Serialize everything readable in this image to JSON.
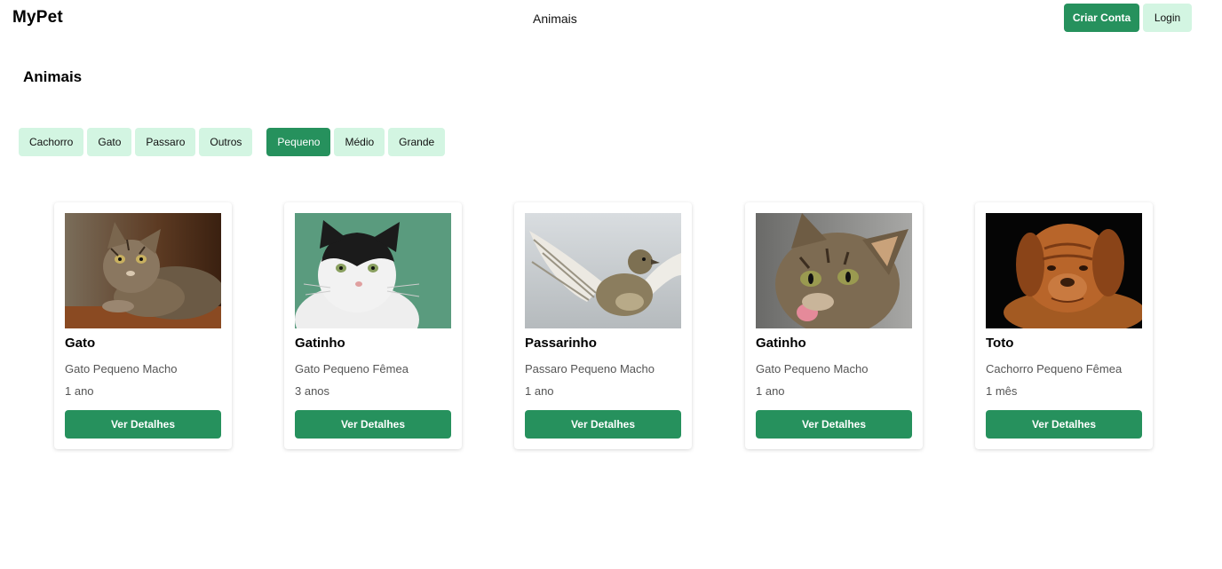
{
  "header": {
    "brand": "MyPet",
    "nav_link": "Animais",
    "signup_label": "Criar Conta",
    "login_label": "Login"
  },
  "main": {
    "title": "Animais",
    "species_filters": [
      "Cachorro",
      "Gato",
      "Passaro",
      "Outros"
    ],
    "size_filters": [
      "Pequeno",
      "Médio",
      "Grande"
    ],
    "active_size_filter": "Pequeno",
    "cards": [
      {
        "name": "Gato",
        "description": "Gato Pequeno Macho",
        "age": "1 ano",
        "button": "Ver Detalhes",
        "photo": "tabby-cat-lying-photo"
      },
      {
        "name": "Gatinho",
        "description": "Gato Pequeno Fêmea",
        "age": "3 anos",
        "button": "Ver Detalhes",
        "photo": "black-white-cat-photo"
      },
      {
        "name": "Passarinho",
        "description": "Passaro Pequeno Macho",
        "age": "1 ano",
        "button": "Ver Detalhes",
        "photo": "sparrow-flying-photo"
      },
      {
        "name": "Gatinho",
        "description": "Gato Pequeno Macho",
        "age": "1 ano",
        "button": "Ver Detalhes",
        "photo": "tabby-cat-tongue-photo"
      },
      {
        "name": "Toto",
        "description": "Cachorro Pequeno Fêmea",
        "age": "1 mês",
        "button": "Ver Detalhes",
        "photo": "brown-puppy-photo"
      }
    ]
  },
  "colors": {
    "primary": "#26915d",
    "chip_light": "#d3f5e2"
  }
}
